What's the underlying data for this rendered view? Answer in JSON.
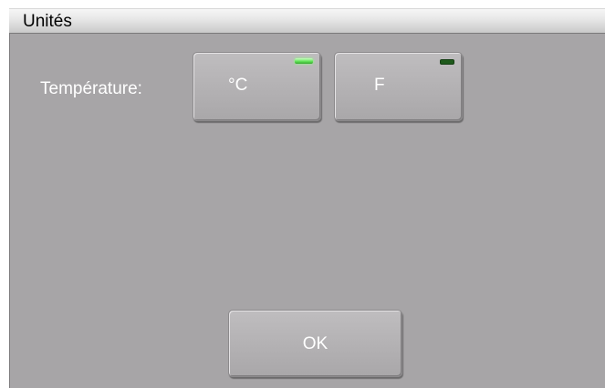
{
  "window": {
    "title": "Unités"
  },
  "temperature": {
    "label": "Température:",
    "options": [
      {
        "label": "°C",
        "selected": true
      },
      {
        "label": "F",
        "selected": false
      }
    ]
  },
  "actions": {
    "ok_label": "OK"
  },
  "colors": {
    "panel_bg": "#a7a5a7",
    "led_on": "#63e35a",
    "led_off": "#1f5a1c",
    "text": "#ffffff"
  }
}
